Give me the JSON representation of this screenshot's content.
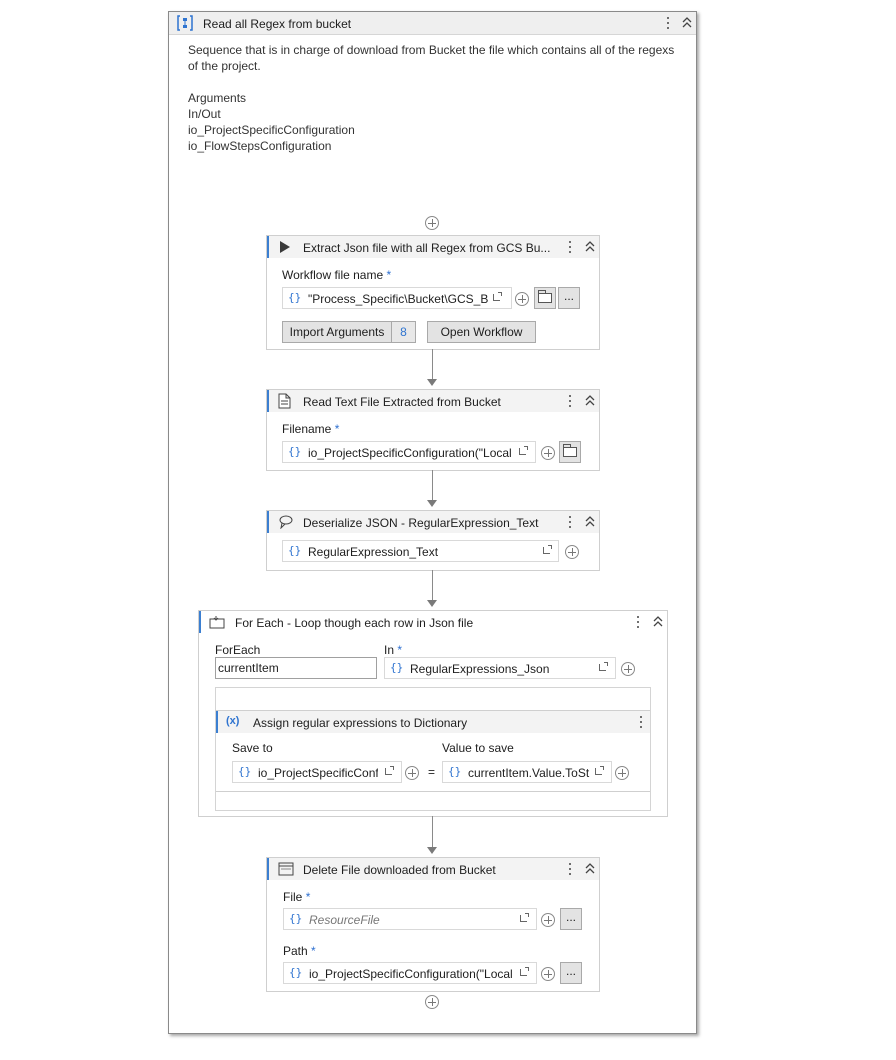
{
  "sequence": {
    "title": "Read all Regex from bucket",
    "description_line1": "Sequence that is in charge of download from Bucket the file which contains all of the regexs",
    "description_line2": "of the project.",
    "arguments_label": "Arguments",
    "inout_label": "In/Out",
    "arg1": "io_ProjectSpecificConfiguration",
    "arg2": "io_FlowStepsConfiguration"
  },
  "invoke": {
    "title": "Extract Json file with all Regex from GCS Bu...",
    "field_label": "Workflow file name",
    "required": "*",
    "value": "\"Process_Specific\\Bucket\\GCS_Buc",
    "import_label": "Import Arguments",
    "import_count": "8",
    "open_label": "Open Workflow",
    "dots": "..."
  },
  "read_text": {
    "title": "Read Text File Extracted from Bucket",
    "field_label": "Filename",
    "required": "*",
    "value": "io_ProjectSpecificConfiguration(\"Local"
  },
  "deserialize": {
    "title": "Deserialize JSON - RegularExpression_Text",
    "value": "RegularExpression_Text"
  },
  "foreach": {
    "title": "For Each - Loop though each row in Json file",
    "foreach_label": "ForEach",
    "item_value": "currentItem",
    "in_label": "In",
    "required": "*",
    "in_value": "RegularExpressions_Json"
  },
  "assign": {
    "title": "Assign regular expressions to Dictionary",
    "icon_text": "(x)",
    "saveto_label": "Save to",
    "saveto_value": "io_ProjectSpecificConf",
    "equals": "=",
    "value_label": "Value to save",
    "value_value": "currentItem.Value.ToSt"
  },
  "delete": {
    "title": "Delete File downloaded from Bucket",
    "file_label": "File",
    "required": "*",
    "file_placeholder": "ResourceFile",
    "path_label": "Path",
    "path_value": "io_ProjectSpecificConfiguration(\"Local",
    "dots": "..."
  },
  "brace": "{}",
  "colors": {
    "accent": "#3b7fd1",
    "brace": "#2f74d0",
    "required": "#2d6fd0"
  }
}
